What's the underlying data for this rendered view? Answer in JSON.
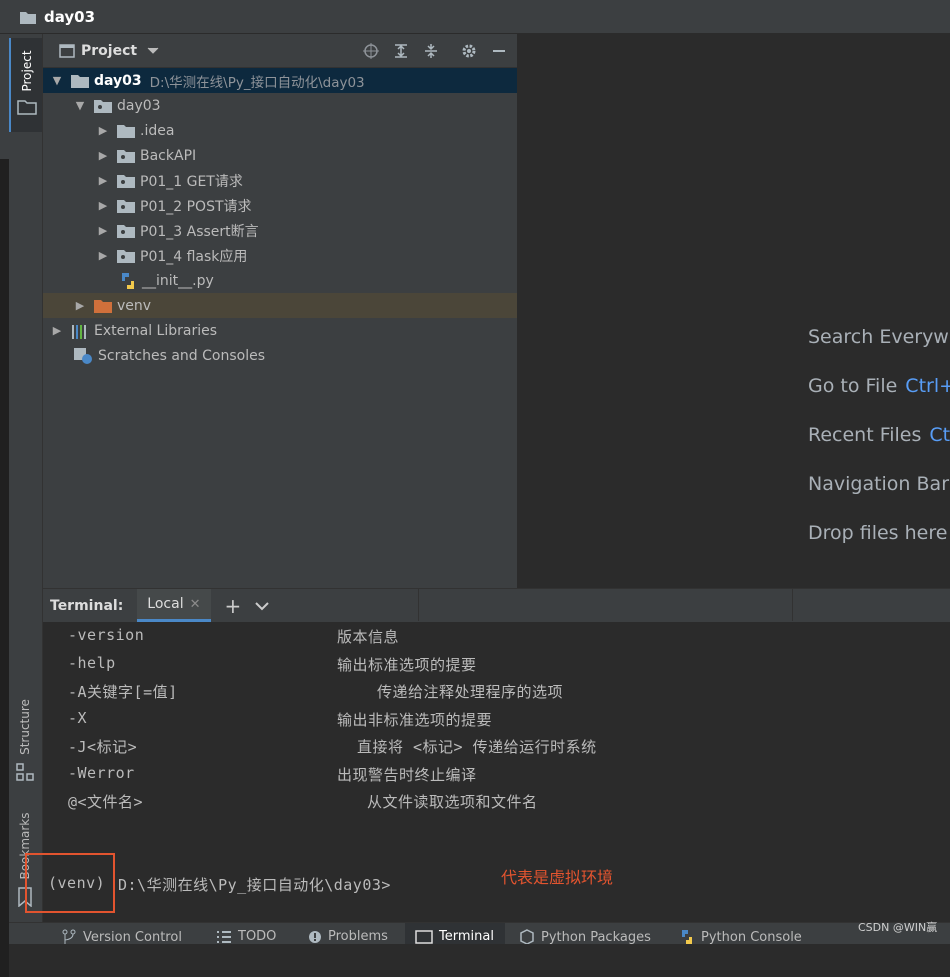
{
  "window": {
    "title": "day03"
  },
  "toolstrip": {
    "project_tab": "Project",
    "structure_tab": "Structure",
    "bookmarks_tab": "Bookmarks"
  },
  "project_panel": {
    "title": "Project",
    "tree": [
      {
        "label": "day03",
        "path": "D:\\华测在线\\Py_接口自动化\\day03"
      },
      {
        "label": "day03"
      },
      {
        "label": ".idea"
      },
      {
        "label": "BackAPI"
      },
      {
        "label": "P01_1 GET请求"
      },
      {
        "label": "P01_2 POST请求"
      },
      {
        "label": "P01_3 Assert断言"
      },
      {
        "label": "P01_4 flask应用"
      },
      {
        "label": "__init__.py"
      },
      {
        "label": "venv"
      },
      {
        "label": "External Libraries"
      },
      {
        "label": "Scratches and Consoles"
      }
    ]
  },
  "editor": {
    "welcome": [
      {
        "text": "Search Everywh",
        "key": ""
      },
      {
        "text": "Go to File",
        "key": "Ctrl+"
      },
      {
        "text": "Recent Files",
        "key": "Ctr"
      },
      {
        "text": "Navigation Bar",
        "key": ""
      },
      {
        "text": "Drop files here",
        "key": ""
      }
    ]
  },
  "terminal": {
    "label": "Terminal:",
    "tab_name": "Local",
    "lines": [
      {
        "opt": "-version",
        "desc": "版本信息"
      },
      {
        "opt": "-help",
        "desc": "输出标准选项的提要"
      },
      {
        "opt": "-A关键字[=值]",
        "desc": "传递给注释处理程序的选项"
      },
      {
        "opt": "-X",
        "desc": "输出非标准选项的提要"
      },
      {
        "opt": "-J<标记>",
        "desc": "直接将 <标记> 传递给运行时系统"
      },
      {
        "opt": "-Werror",
        "desc": "出现警告时终止编译"
      },
      {
        "opt": "@<文件名>",
        "desc": "从文件读取选项和文件名"
      }
    ],
    "prompt_venv": "(venv)",
    "prompt_path": "D:\\华测在线\\Py_接口自动化\\day03>"
  },
  "annotation": {
    "text": "代表是虚拟环境",
    "color": "#e2542f"
  },
  "watermark": "CSDN @WIN赢",
  "bottom_tabs": [
    {
      "label": "Version Control",
      "icon": "branch-icon"
    },
    {
      "label": "TODO",
      "icon": "list-icon"
    },
    {
      "label": "Problems",
      "icon": "warning-icon"
    },
    {
      "label": "Terminal",
      "icon": "terminal-icon",
      "active": true
    },
    {
      "label": "Python Packages",
      "icon": "packages-icon"
    },
    {
      "label": "Python Console",
      "icon": "python-icon"
    }
  ]
}
